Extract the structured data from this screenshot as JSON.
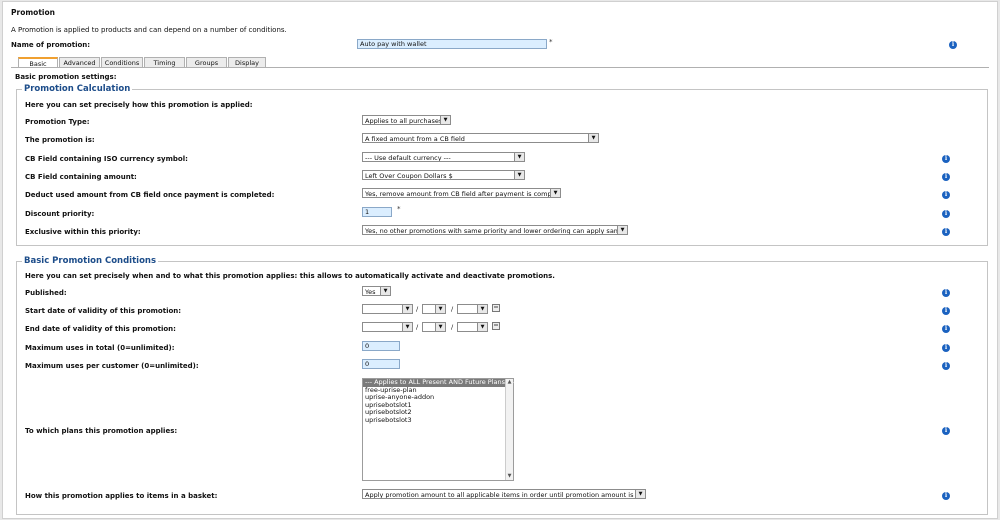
{
  "header": {
    "title": "Promotion",
    "description": "A Promotion is applied to products and can depend on a number of conditions.",
    "name_label": "Name of promotion:",
    "name_value": "Auto pay with wallet",
    "required_mark": "*"
  },
  "tabs": [
    "Basic",
    "Advanced",
    "Conditions",
    "Timing",
    "Groups",
    "Display"
  ],
  "basic_settings_label": "Basic promotion settings:",
  "calculation": {
    "legend": "Promotion Calculation",
    "intro": "Here you can set precisely how this promotion is applied:",
    "promotion_type_label": "Promotion Type:",
    "promotion_type_value": "Applies to all purchases",
    "promotion_is_label": "The promotion is:",
    "promotion_is_value": "A fixed amount from a CB field",
    "cb_currency_label": "CB Field containing ISO currency symbol:",
    "cb_currency_value": "--- Use default currency ---",
    "cb_amount_label": "CB Field containing amount:",
    "cb_amount_value": "Left Over Coupon Dollars $",
    "deduct_label": "Deduct used amount from CB field once payment is completed:",
    "deduct_value": "Yes, remove amount from CB field after payment is completed",
    "priority_label": "Discount priority:",
    "priority_value": "1",
    "exclusive_label": "Exclusive within this priority:",
    "exclusive_value": "Yes, no other promotions with same priority and lower ordering can apply same time"
  },
  "conditions": {
    "legend": "Basic Promotion Conditions",
    "intro": "Here you can set precisely when and to what this promotion applies: this allows to automatically activate and deactivate promotions.",
    "published_label": "Published:",
    "published_value": "Yes",
    "start_label": "Start date of validity of this promotion:",
    "end_label": "End date of validity of this promotion:",
    "date_separator": "/",
    "max_total_label": "Maximum uses in total (0=unlimited):",
    "max_total_value": "0",
    "max_customer_label": "Maximum uses per customer (0=unlimited):",
    "max_customer_value": "0",
    "plans_label": "To which plans this promotion applies:",
    "plans": [
      "--- Applies to ALL Present AND Future Plans ---",
      "free-uprise-plan",
      "uprise-anyone-addon",
      "uprisebotslot1",
      "uprisebotslot2",
      "uprisebotslot3"
    ],
    "basket_label": "How this promotion applies to items in a basket:",
    "basket_value": "Apply promotion amount to all applicable items in order until promotion amount is depleted"
  },
  "icons": {
    "info": "info-icon",
    "calendar": "calendar-icon",
    "dropdown": "dropdown-arrow-icon"
  },
  "colors": {
    "legend": "#1d4d8a",
    "input_bg": "#dbeeff",
    "info_icon": "#1b62c0",
    "active_tab": "#f0a030"
  }
}
